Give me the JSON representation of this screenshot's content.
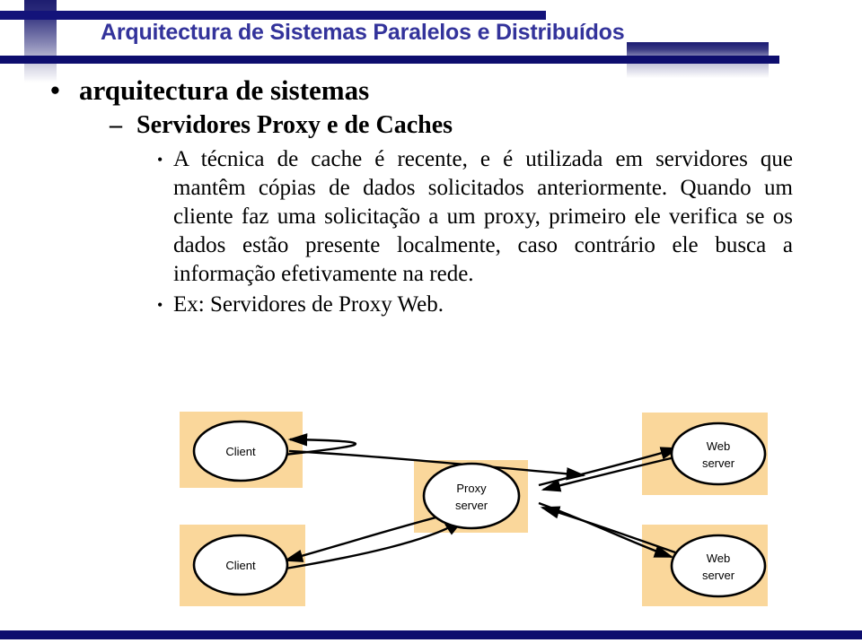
{
  "header": {
    "title": "Arquitectura de Sistemas Paralelos e Distribuídos",
    "accent_color": "#33339b",
    "bar_color": "#0d0d6e"
  },
  "content": {
    "level1": {
      "bullet": "•",
      "text": "arquitectura de sistemas"
    },
    "level2": {
      "bullet": "–",
      "text": "Servidores Proxy e de Caches"
    },
    "level3_paragraph": {
      "bullet": "•",
      "text": "A técnica de cache é recente, e é utilizada em servidores que mantêm cópias de dados solicitados anteriormente. Quando um cliente faz uma solicitação a um proxy, primeiro ele verifica se os dados estão presente localmente, caso contrário ele busca a informação efetivamente na rede."
    },
    "level3_example": {
      "bullet": "•",
      "text": "Ex: Servidores de Proxy Web."
    }
  },
  "diagram": {
    "box_fill": "#fad79b",
    "node_fill": "#ffffff",
    "stroke": "#000000",
    "nodes": [
      {
        "id": "client-top",
        "label_line1": "Client",
        "label_line2": ""
      },
      {
        "id": "client-bottom",
        "label_line1": "Client",
        "label_line2": ""
      },
      {
        "id": "proxy-server",
        "label_line1": "Proxy",
        "label_line2": "server"
      },
      {
        "id": "web-server-top",
        "label_line1": "Web",
        "label_line2": "server"
      },
      {
        "id": "web-server-bottom",
        "label_line1": "Web",
        "label_line2": "server"
      }
    ],
    "edges": [
      {
        "from": "proxy-server",
        "to": "client-top"
      },
      {
        "from": "client-top",
        "to": "proxy-server"
      },
      {
        "from": "proxy-server",
        "to": "client-bottom"
      },
      {
        "from": "client-bottom",
        "to": "proxy-server"
      },
      {
        "from": "proxy-server",
        "to": "web-server-top"
      },
      {
        "from": "web-server-top",
        "to": "proxy-server"
      },
      {
        "from": "proxy-server",
        "to": "web-server-bottom"
      },
      {
        "from": "web-server-bottom",
        "to": "proxy-server"
      }
    ]
  }
}
